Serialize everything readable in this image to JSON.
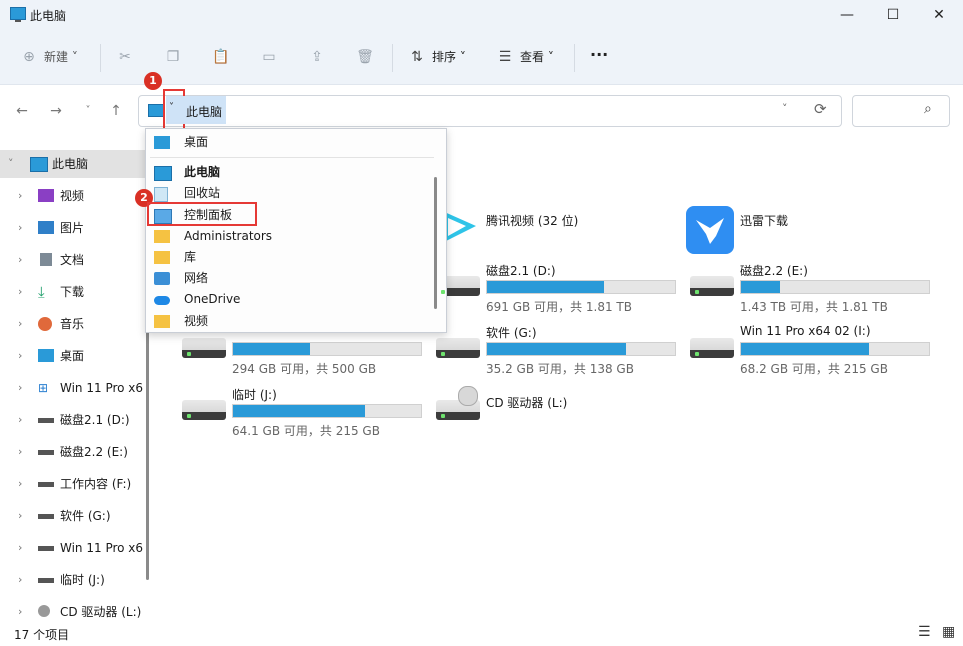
{
  "window": {
    "title": "此电脑",
    "minimize_glyph": "—",
    "maximize_glyph": "☐",
    "close_glyph": "✕"
  },
  "toolbar": {
    "new_label": "新建",
    "sort_label": "排序",
    "view_label": "查看",
    "more_label": "···"
  },
  "address": {
    "path": "此电脑",
    "refresh_glyph": "⟳",
    "search_placeholder": ""
  },
  "sidebar": {
    "items": [
      {
        "label": "此电脑"
      },
      {
        "label": "视频"
      },
      {
        "label": "图片"
      },
      {
        "label": "文档"
      },
      {
        "label": "下载"
      },
      {
        "label": "音乐"
      },
      {
        "label": "桌面"
      },
      {
        "label": "Win 11 Pro x6"
      },
      {
        "label": "磁盘2.1 (D:)"
      },
      {
        "label": "磁盘2.2 (E:)"
      },
      {
        "label": "工作内容 (F:)"
      },
      {
        "label": "软件 (G:)"
      },
      {
        "label": "Win 11 Pro x6"
      },
      {
        "label": "临时 (J:)"
      },
      {
        "label": "CD 驱动器 (L:)"
      }
    ]
  },
  "content": {
    "apps": [
      {
        "name": "腾讯视频 (32 位)"
      },
      {
        "name": "迅雷下载"
      }
    ],
    "drives": [
      {
        "name": "磁盘2.1 (D:)",
        "info": "691 GB 可用，共 1.81 TB",
        "used_fraction": 0.62
      },
      {
        "name": "磁盘2.2 (E:)",
        "info": "1.43 TB 可用，共 1.81 TB",
        "used_fraction": 0.21
      },
      {
        "name": "",
        "info": "294 GB 可用，共 500 GB",
        "used_fraction": 0.41
      },
      {
        "name": "软件 (G:)",
        "info": "35.2 GB 可用，共 138 GB",
        "used_fraction": 0.74
      },
      {
        "name": "Win 11 Pro x64 02 (I:)",
        "info": "68.2 GB 可用，共 215 GB",
        "used_fraction": 0.68
      },
      {
        "name": "临时 (J:)",
        "info": "64.1 GB 可用，共 215 GB",
        "used_fraction": 0.7
      },
      {
        "name": "CD 驱动器 (L:)",
        "info": "",
        "used_fraction": null
      }
    ]
  },
  "dropdown": {
    "items": [
      {
        "label": "桌面"
      },
      {
        "label": "此电脑"
      },
      {
        "label": "回收站"
      },
      {
        "label": "控制面板"
      },
      {
        "label": "Administrators"
      },
      {
        "label": "库"
      },
      {
        "label": "网络"
      },
      {
        "label": "OneDrive"
      },
      {
        "label": "视频"
      }
    ]
  },
  "annotations": {
    "badge1": "1",
    "badge2": "2"
  },
  "statusbar": {
    "count": "17 个项目"
  },
  "colors": {
    "accent": "#2a9ad8",
    "highlight": "#e53935"
  }
}
